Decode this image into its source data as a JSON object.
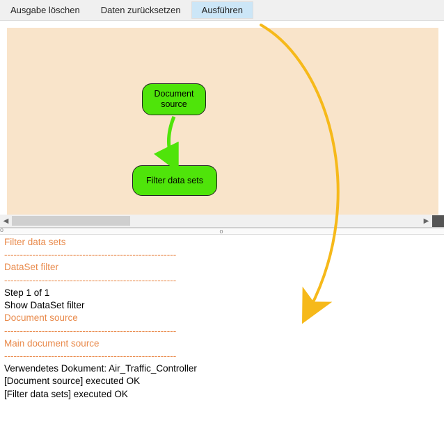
{
  "toolbar": {
    "clear_output": "Ausgabe löschen",
    "reset_data": "Daten zurücksetzen",
    "execute": "Ausführen"
  },
  "nodes": {
    "document_source": "Document source",
    "filter_data_sets": "Filter data sets"
  },
  "output": {
    "lines": [
      {
        "text": "Filter data sets",
        "cls": "out-orange"
      },
      {
        "text": "-------------------------------------------------------",
        "cls": "out-orange"
      },
      {
        "text": "DataSet filter",
        "cls": "out-orange"
      },
      {
        "text": "-------------------------------------------------------",
        "cls": "out-orange"
      },
      {
        "text": "Step 1 of 1",
        "cls": ""
      },
      {
        "text": "Show DataSet filter",
        "cls": ""
      },
      {
        "text": "Document source",
        "cls": "out-orange"
      },
      {
        "text": "-------------------------------------------------------",
        "cls": "out-orange"
      },
      {
        "text": "Main document source",
        "cls": "out-orange"
      },
      {
        "text": "-------------------------------------------------------",
        "cls": "out-orange"
      },
      {
        "text": "Verwendetes Dokument: Air_Traffic_Controller",
        "cls": ""
      },
      {
        "text": "[Document source] executed OK",
        "cls": ""
      },
      {
        "text": "[Filter data sets] executed OK",
        "cls": ""
      }
    ]
  },
  "colors": {
    "node_fill": "#4fe40a",
    "canvas_bg": "#f9e4ca",
    "highlight_bg": "#cce6f7",
    "output_accent": "#e98a4b",
    "annotation": "#f6b91a"
  }
}
